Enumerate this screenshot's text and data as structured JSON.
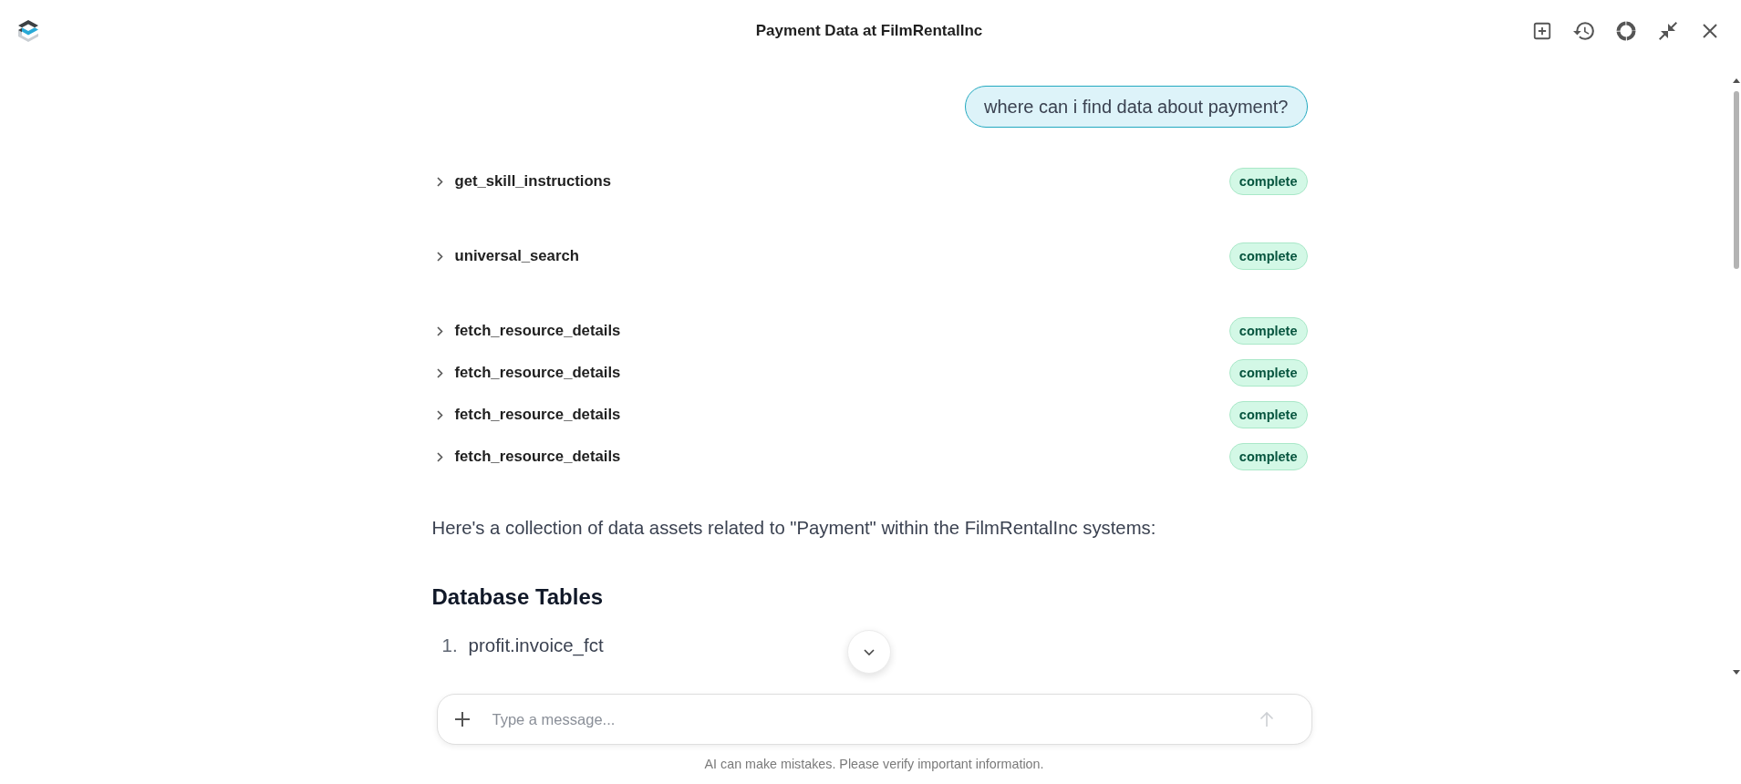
{
  "header": {
    "title": "Payment Data at FilmRentalInc"
  },
  "user_message": {
    "text": "where can i find data about payment?"
  },
  "tool_call_groups": [
    {
      "calls": [
        {
          "name": "get_skill_instructions",
          "status": "complete",
          "expanded": false
        }
      ]
    },
    {
      "calls": [
        {
          "name": "universal_search",
          "status": "complete",
          "expanded": false
        }
      ]
    },
    {
      "calls": [
        {
          "name": "fetch_resource_details",
          "status": "complete",
          "expanded": false
        },
        {
          "name": "fetch_resource_details",
          "status": "complete",
          "expanded": false
        },
        {
          "name": "fetch_resource_details",
          "status": "complete",
          "expanded": false
        },
        {
          "name": "fetch_resource_details",
          "status": "complete",
          "expanded": false
        }
      ]
    }
  ],
  "response": {
    "intro": "Here's a collection of data assets related to \"Payment\" within the FilmRentalInc systems:",
    "sections": [
      {
        "heading": "Database Tables",
        "items": [
          {
            "number": "1.",
            "text": "profit.invoice_fct"
          }
        ]
      }
    ]
  },
  "composer": {
    "placeholder": "Type a message...",
    "send_disabled": true
  },
  "footnote": "AI can make mistakes. Please verify important information."
}
